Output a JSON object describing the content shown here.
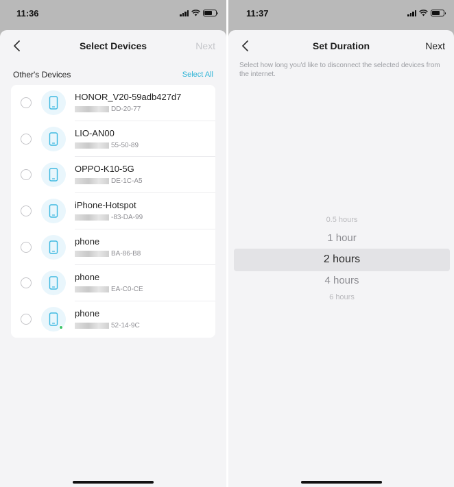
{
  "left_screen": {
    "status": {
      "time": "11:36"
    },
    "nav": {
      "title": "Select Devices",
      "next_label": "Next"
    },
    "section": {
      "title": "Other's Devices",
      "select_all_label": "Select All"
    },
    "devices": [
      {
        "name": "HONOR_V20-59adb427d7",
        "mac_suffix": "DD-20-77",
        "online": false
      },
      {
        "name": "LIO-AN00",
        "mac_suffix": "55-50-89",
        "online": false
      },
      {
        "name": "OPPO-K10-5G",
        "mac_suffix": "DE-1C-A5",
        "online": false
      },
      {
        "name": "iPhone-Hotspot",
        "mac_suffix": "-83-DA-99",
        "online": false
      },
      {
        "name": "phone",
        "mac_suffix": "BA-86-B8",
        "online": false
      },
      {
        "name": "phone",
        "mac_suffix": "EA-C0-CE",
        "online": false
      },
      {
        "name": "phone",
        "mac_suffix": "52-14-9C",
        "online": true
      }
    ]
  },
  "right_screen": {
    "status": {
      "time": "11:37"
    },
    "nav": {
      "title": "Set Duration",
      "next_label": "Next"
    },
    "description": "Select how long you'd like to disconnect the selected devices from the internet.",
    "picker": {
      "options": [
        "0.5 hours",
        "1 hour",
        "2 hours",
        "4 hours",
        "6 hours"
      ],
      "selected": "2 hours"
    }
  },
  "colors": {
    "accent": "#2db3d6",
    "background": "#f4f4f6",
    "online": "#3cc46a",
    "disabled_text": "#c6c7cb"
  },
  "icons": [
    "back-chevron-icon",
    "phone-icon",
    "signal-icon",
    "wifi-icon",
    "battery-icon"
  ]
}
